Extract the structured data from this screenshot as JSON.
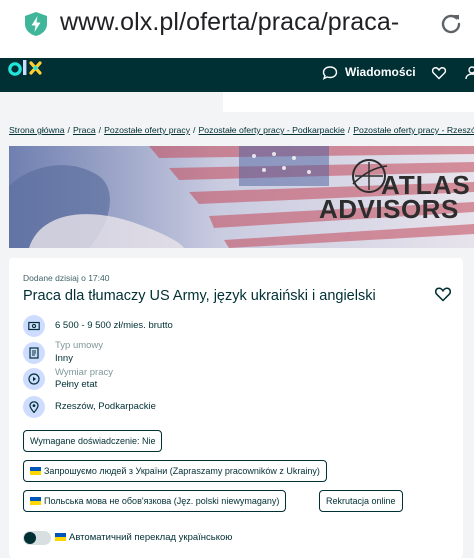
{
  "browser": {
    "url": "www.olx.pl/oferta/praca/praca-",
    "shield_icon": "shield-lightning-icon",
    "reload_icon": "reload-icon"
  },
  "header": {
    "logo": "olx",
    "messages_label": "Wiadomości",
    "icons": [
      "chat-icon",
      "heart-icon",
      "user-icon"
    ],
    "bg_color": "#002f34",
    "logo_colors": [
      "#23e5db",
      "#ceddff",
      "#ffce32"
    ]
  },
  "breadcrumb": {
    "items": [
      "Strona główna",
      "Praca",
      "Pozostałe oferty pracy",
      "Pozostałe oferty pracy - Podkarpackie",
      "Pozostałe oferty pracy - Rzeszów"
    ],
    "separator": "/"
  },
  "banner": {
    "brand_line1": "ATLAS",
    "brand_line2": "ADVISORS"
  },
  "listing": {
    "posted": "Dodane dzisiaj o 17:40",
    "title": "Praca dla tłumaczy US Army, język ukraiński i angielski",
    "salary": "6 500 - 9 500 zł/mies. brutto",
    "contract_label": "Typ umowy",
    "contract_value": "Inny",
    "hours_label": "Wymiar pracy",
    "hours_value": "Pełny etat",
    "location": "Rzeszów, Podkarpackie",
    "tags": {
      "experience": "Wymagane doświadczenie: Nie",
      "ukraine": "Запрошуємо людей з України (Zapraszamy pracowników z Ukrainy)",
      "polish": "Польська мова не обов'язкова (Jęz. polski niewymagany)",
      "online": "Rekrutacja online"
    },
    "translate_label": "Автоматичний переклад українською",
    "translate_on": false
  }
}
